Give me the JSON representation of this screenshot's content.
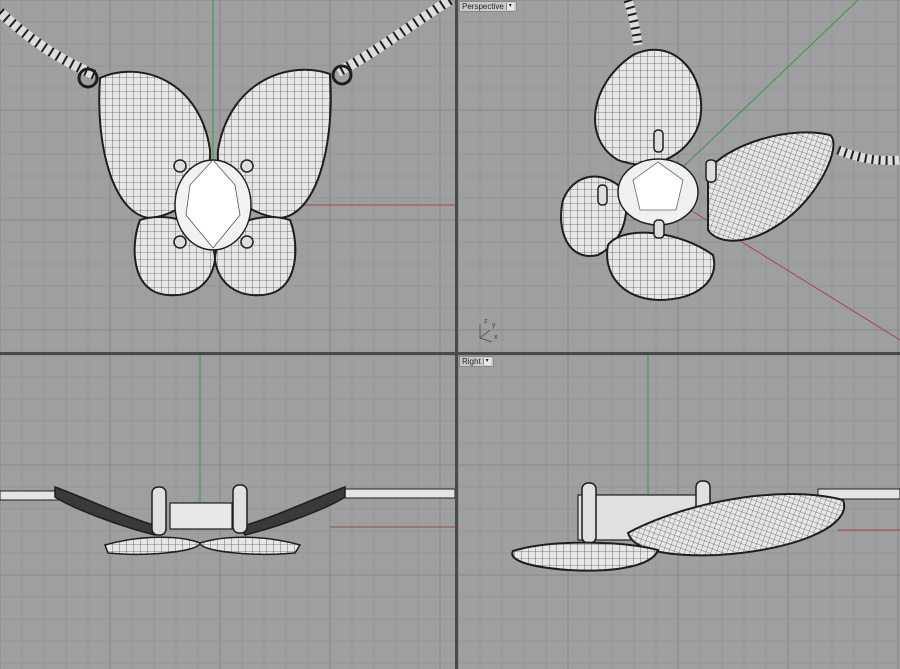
{
  "app": {
    "layout": "four-viewport"
  },
  "viewports": [
    {
      "id": "top",
      "label": ""
    },
    {
      "id": "perspective",
      "label": "Perspective"
    },
    {
      "id": "front",
      "label": ""
    },
    {
      "id": "right",
      "label": "Right"
    }
  ],
  "axis_indicator": {
    "z": "z",
    "y": "y",
    "x": "x"
  },
  "colors": {
    "viewport_bg": "#9d9fa1",
    "grid_minor": "#929496",
    "grid_major": "#858789",
    "axis_x": "#b04040",
    "axis_y": "#3a9a3a",
    "model_fill": "#e9e9e9",
    "model_line": "#1e1e1e",
    "border": "#4a4a4a"
  },
  "icons": {
    "dropdown": "chevron-down-icon",
    "axis_widget": "axis-triad-icon"
  }
}
